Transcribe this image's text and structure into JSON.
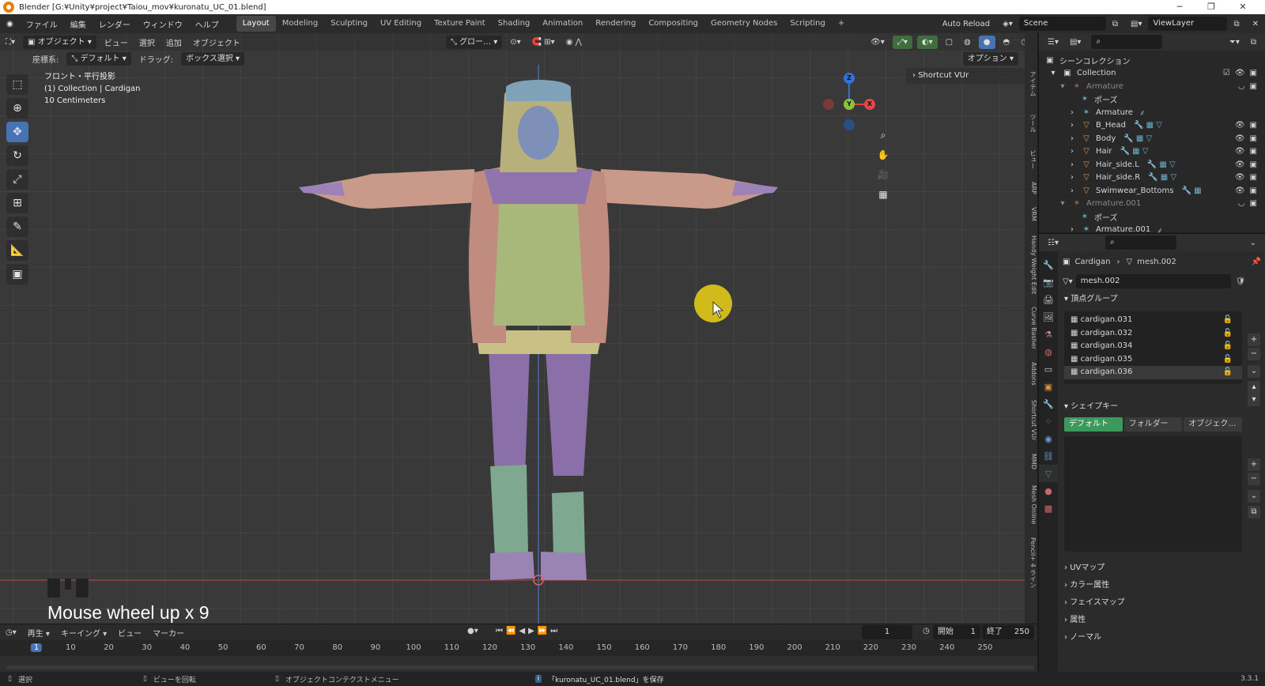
{
  "window": {
    "title": "Blender [G:¥Unity¥project¥Taiou_mov¥kuronatu_UC_01.blend]"
  },
  "menu": {
    "items": [
      "ファイル",
      "編集",
      "レンダー",
      "ウィンドウ",
      "ヘルプ"
    ]
  },
  "workspaces": {
    "tabs": [
      "Layout",
      "Modeling",
      "Sculpting",
      "UV Editing",
      "Texture Paint",
      "Shading",
      "Animation",
      "Rendering",
      "Compositing",
      "Geometry Nodes",
      "Scripting"
    ],
    "active": "Layout",
    "add": "+"
  },
  "topright": {
    "auto_reload": "Auto Reload",
    "scene": "Scene",
    "view_layer": "ViewLayer"
  },
  "viewport_header": {
    "mode": "オブジェクト",
    "menus": [
      "ビュー",
      "選択",
      "追加",
      "オブジェクト"
    ],
    "transform_orientation": "グロー…",
    "coord_label": "座標系:",
    "coord_value": "デフォルト",
    "drag_label": "ドラッグ:",
    "drag_value": "ボックス選択",
    "options": "オプション"
  },
  "viewport_info": {
    "line1": "フロント・平行投影",
    "line2": "(1) Collection | Cardigan",
    "line3": "10 Centimeters"
  },
  "shortcut_panel": {
    "label": "Shortcut VUr"
  },
  "gizmo": {
    "z": "Z",
    "y": "Y",
    "x": "X"
  },
  "side_tabs": [
    "アイテム",
    "ツール",
    "ビュー",
    "ARP",
    "VRM",
    "Handy Weight Edit",
    "Curve Basher",
    "Addons",
    "Shortcut VUr",
    "MMD",
    "Mesh Online",
    "Pencil+ 4 ライン"
  ],
  "overlay": {
    "keystroke": "Mouse wheel up x 9"
  },
  "outliner": {
    "scene_collection": "シーンコレクション",
    "rows": [
      {
        "name": "Collection",
        "depth": 1,
        "icon": "collection-icon",
        "dim": false
      },
      {
        "name": "Armature",
        "depth": 2,
        "icon": "armature-icon",
        "dim": true
      },
      {
        "name": "ポーズ",
        "depth": 3,
        "icon": "pose-icon",
        "dim": false
      },
      {
        "name": "Armature",
        "depth": 3,
        "icon": "armature-data-icon",
        "dim": false
      },
      {
        "name": "B_Head",
        "depth": 3,
        "icon": "mesh-icon",
        "dim": false
      },
      {
        "name": "Body",
        "depth": 3,
        "icon": "mesh-icon",
        "dim": false
      },
      {
        "name": "Hair",
        "depth": 3,
        "icon": "mesh-icon",
        "dim": false
      },
      {
        "name": "Hair_side.L",
        "depth": 3,
        "icon": "mesh-icon",
        "dim": false
      },
      {
        "name": "Hair_side.R",
        "depth": 3,
        "icon": "mesh-icon",
        "dim": false
      },
      {
        "name": "Swimwear_Bottoms",
        "depth": 3,
        "icon": "mesh-icon",
        "dim": false
      },
      {
        "name": "Armature.001",
        "depth": 2,
        "icon": "armature-icon",
        "dim": true
      },
      {
        "name": "ポーズ",
        "depth": 3,
        "icon": "pose-icon",
        "dim": false
      },
      {
        "name": "Armature.001",
        "depth": 3,
        "icon": "armature-data-icon",
        "dim": false
      }
    ]
  },
  "properties": {
    "breadcrumb_object": "Cardigan",
    "breadcrumb_mesh": "mesh.002",
    "mesh_name": "mesh.002",
    "vertex_groups_title": "頂点グループ",
    "vertex_groups": [
      "cardigan.031",
      "cardigan.032",
      "cardigan.034",
      "cardigan.035",
      "cardigan.036"
    ],
    "selected_vertex_group": "cardigan.036",
    "shape_keys_title": "シェイプキー",
    "shape_tabs": [
      "デフォルト",
      "フォルダー",
      "オブジェク…"
    ],
    "collapsed_sections": [
      "UVマップ",
      "カラー属性",
      "フェイスマップ",
      "属性",
      "ノーマル"
    ]
  },
  "timeline": {
    "menus": [
      "再生",
      "キーイング",
      "ビュー",
      "マーカー"
    ],
    "current_frame": "1",
    "start_label": "開始",
    "start": "1",
    "end_label": "終了",
    "end": "250",
    "ticks": [
      "1",
      "10",
      "20",
      "30",
      "40",
      "50",
      "60",
      "70",
      "80",
      "90",
      "100",
      "110",
      "120",
      "130",
      "140",
      "150",
      "160",
      "170",
      "180",
      "190",
      "200",
      "210",
      "220",
      "230",
      "240",
      "250"
    ]
  },
  "statusbar": {
    "select": "選択",
    "rotate": "ビューを回転",
    "context": "オブジェクトコンテクストメニュー",
    "saved": "「kuronatu_UC_01.blend」を保存",
    "version": "3.3.1"
  },
  "colors": {
    "accent_blue": "#4772b3",
    "active_green": "#3b9a5b",
    "cursor_highlight": "#d9c21a"
  }
}
